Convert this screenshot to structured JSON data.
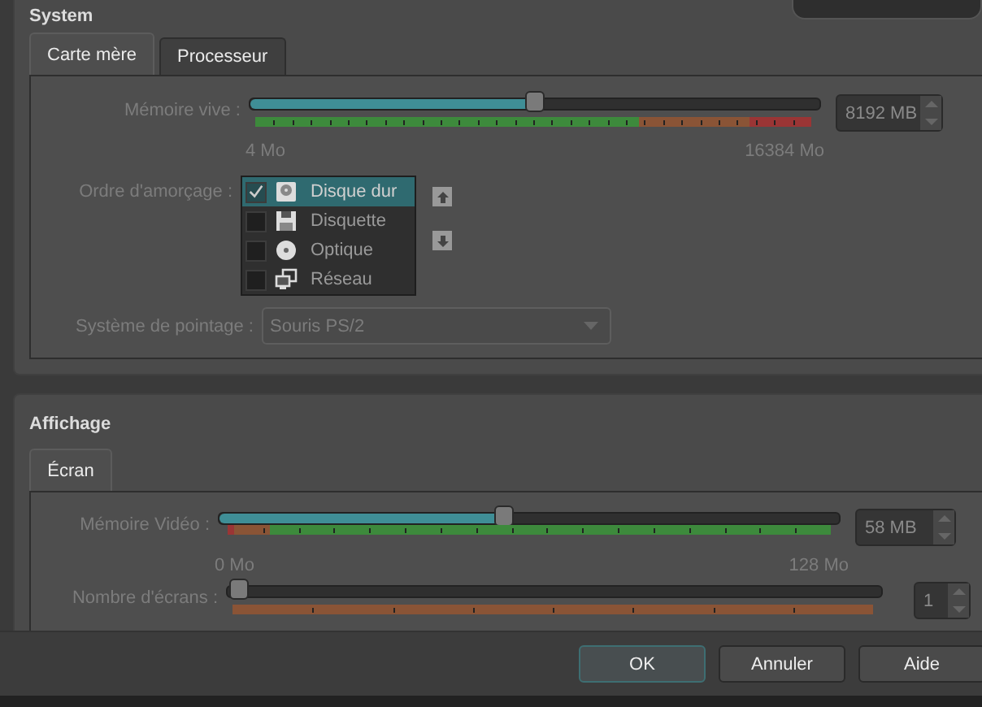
{
  "system": {
    "title": "System",
    "tabs": [
      {
        "label": "Carte mère",
        "selected": true
      },
      {
        "label": "Processeur",
        "selected": false
      }
    ],
    "memory": {
      "label": "Mémoire vive :",
      "level": 0.5,
      "value": "8192 MB",
      "min": "4 Mo",
      "max": "16384 Mo",
      "zones": [
        {
          "color": "#3d8a3c",
          "level": 0.69
        },
        {
          "color": "#8a5436",
          "level": 0.89
        },
        {
          "color": "#9a3535",
          "level": 1
        }
      ]
    },
    "boot_order": {
      "label": "Ordre d'amorçage :",
      "items": [
        {
          "label": "Disque dur",
          "checked": true,
          "selected": true,
          "kind": "disk"
        },
        {
          "label": "Disquette",
          "checked": false,
          "selected": false,
          "kind": "floppy"
        },
        {
          "label": "Optique",
          "checked": false,
          "selected": false,
          "kind": "optical"
        },
        {
          "label": "Réseau",
          "checked": false,
          "selected": false,
          "kind": "network"
        }
      ]
    },
    "pointing": {
      "label": "Système de pointage :",
      "value": "Souris PS/2"
    }
  },
  "display": {
    "title": "Affichage",
    "tabs": [
      {
        "label": "Écran",
        "selected": true
      }
    ],
    "video_memory": {
      "label": "Mémoire Vidéo :",
      "level": 0.46,
      "value": "58 MB",
      "min": "0 Mo",
      "max": "128 Mo",
      "zones": [
        {
          "color": "#9a3535",
          "level": 0.01
        },
        {
          "color": "#8a5436",
          "level": 0.07
        },
        {
          "color": "#3d8a3c",
          "level": 1
        }
      ]
    },
    "screens": {
      "label": "Nombre d'écrans :",
      "level": 0,
      "value": "1",
      "zones": [
        {
          "color": "#8a5436",
          "level": 1
        }
      ]
    }
  },
  "buttons": [
    {
      "label": "OK",
      "default": true
    },
    {
      "label": "Annuler",
      "default": false
    },
    {
      "label": "Aide",
      "default": false
    }
  ]
}
